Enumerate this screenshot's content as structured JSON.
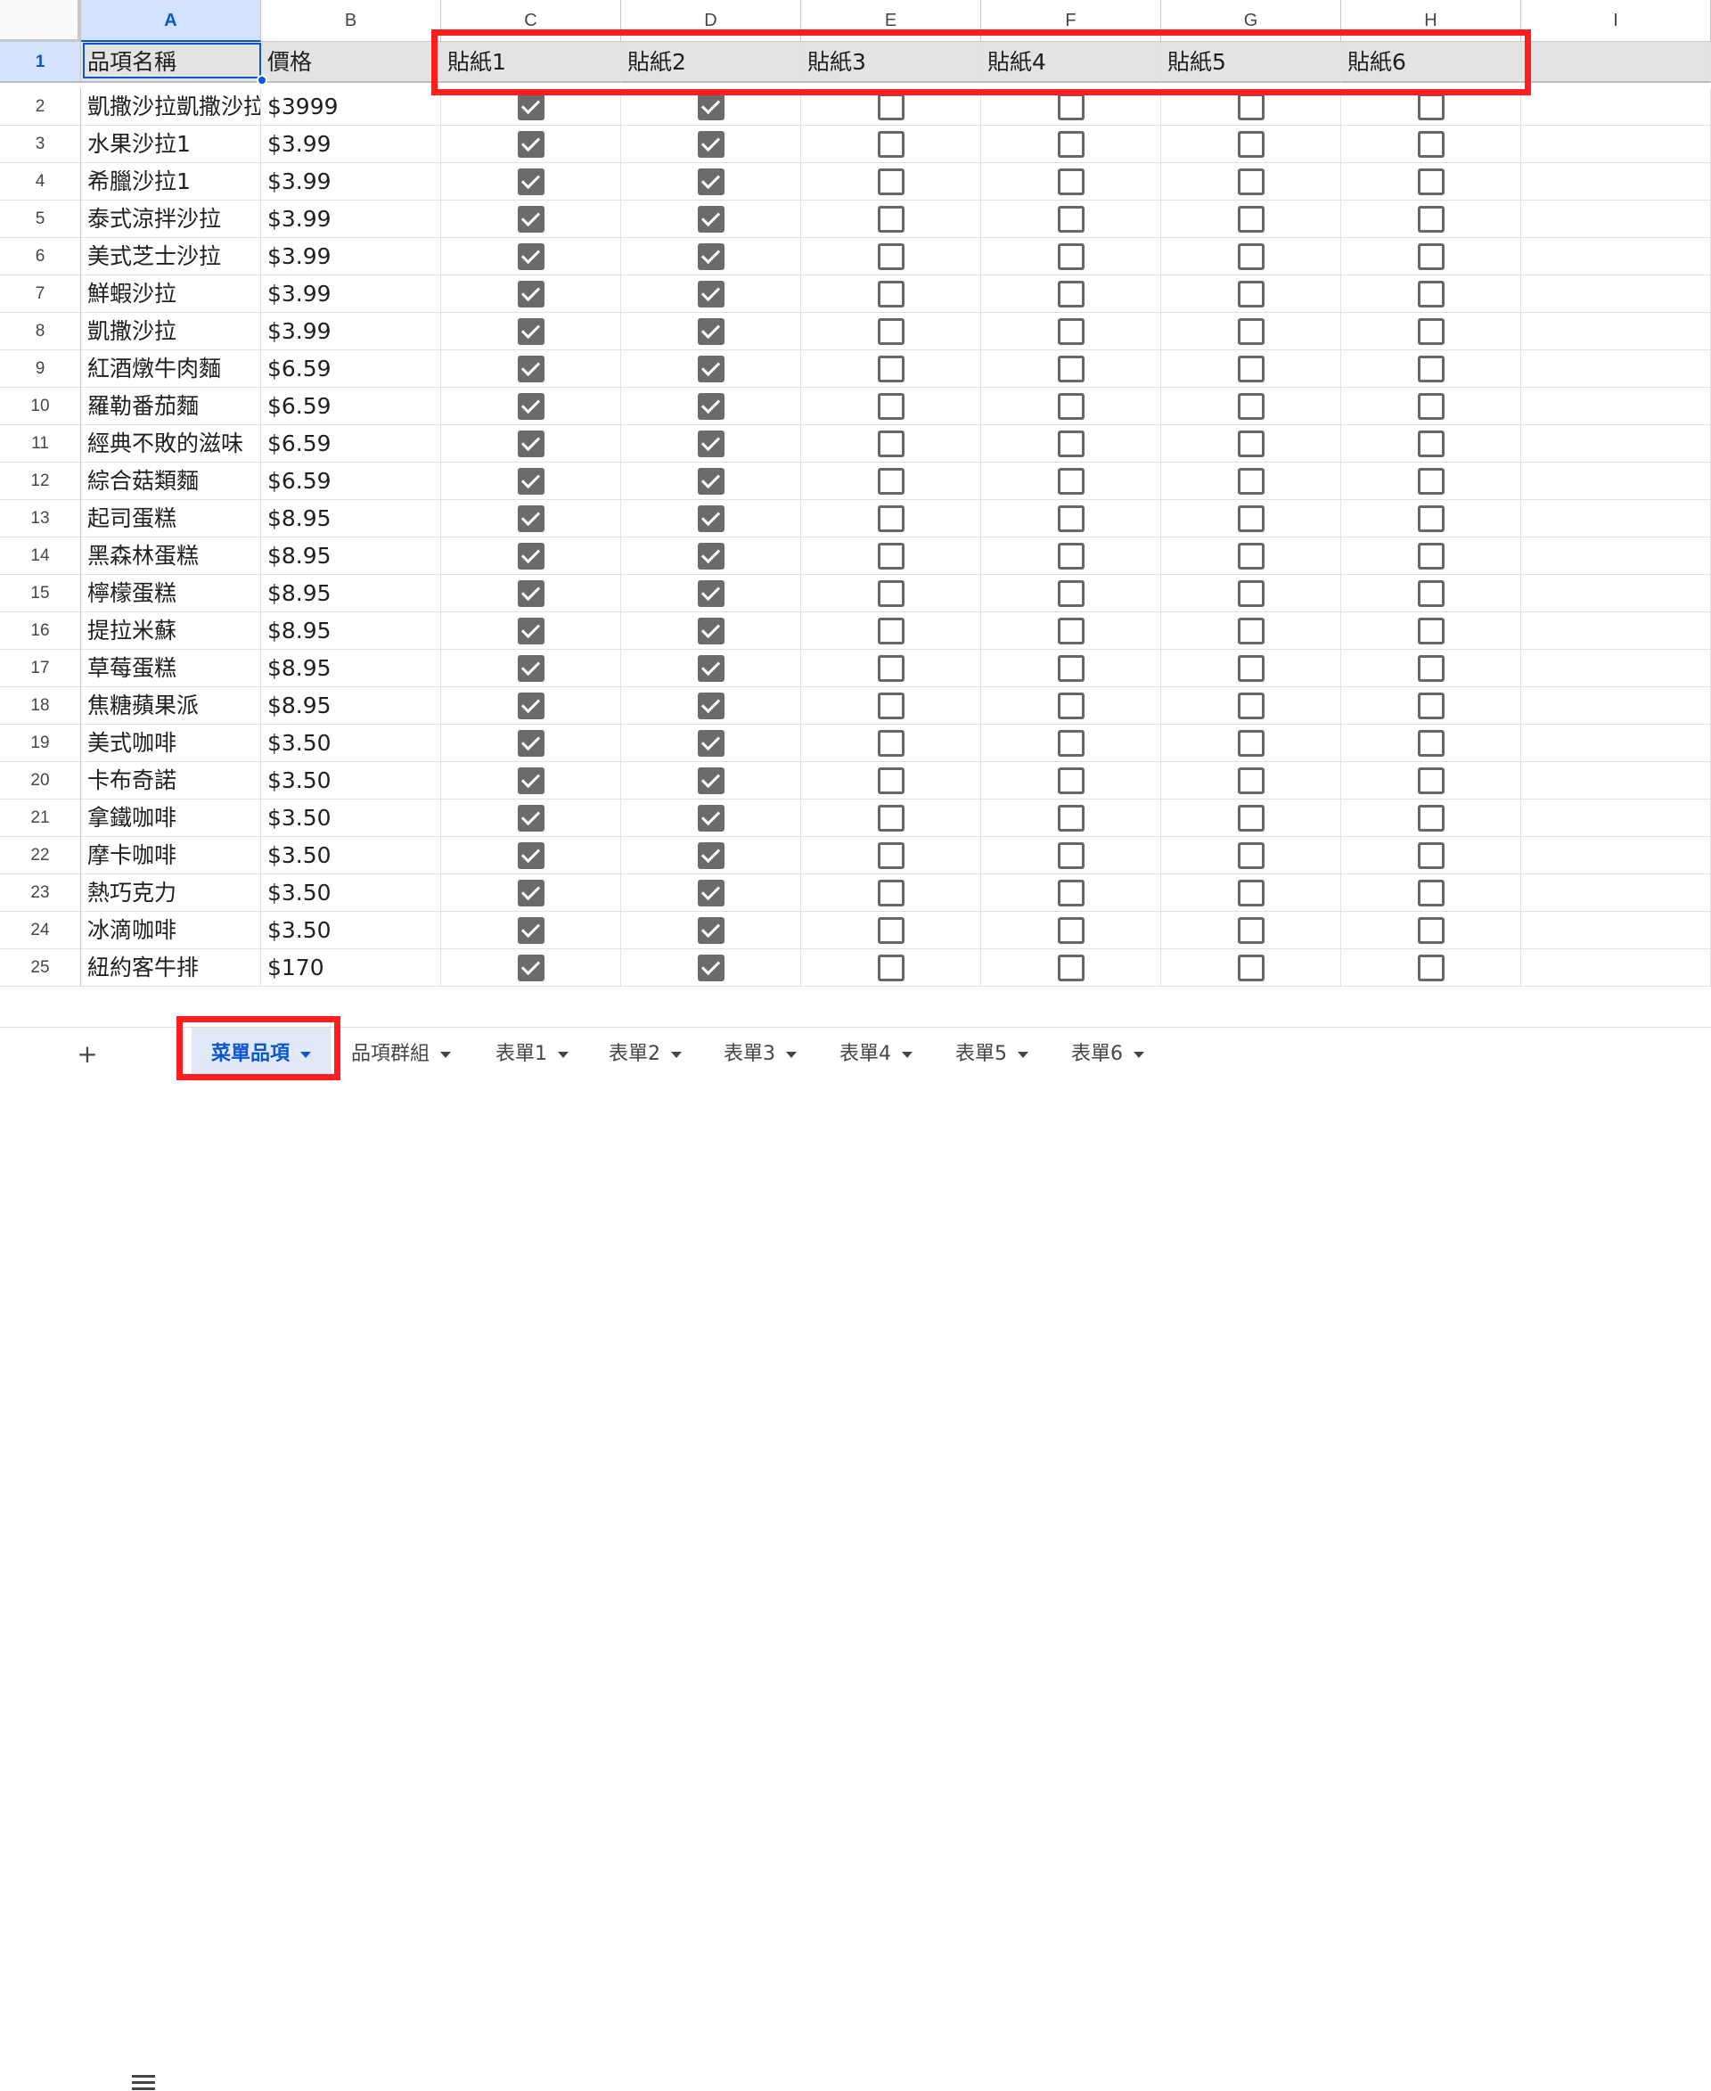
{
  "columns": [
    "A",
    "B",
    "C",
    "D",
    "E",
    "F",
    "G",
    "H",
    "I"
  ],
  "selected_column": "A",
  "selected_row": "1",
  "header_row": {
    "row_number": "1",
    "cells": [
      "品項名稱",
      "價格",
      "貼紙1",
      "貼紙2",
      "貼紙3",
      "貼紙4",
      "貼紙5",
      "貼紙6",
      ""
    ]
  },
  "rows": [
    {
      "n": "2",
      "name": "凱撒沙拉凱撒沙拉",
      "price": "$3999",
      "checks": [
        true,
        true,
        false,
        false,
        false,
        false
      ]
    },
    {
      "n": "3",
      "name": "水果沙拉1",
      "price": "$3.99",
      "checks": [
        true,
        true,
        false,
        false,
        false,
        false
      ]
    },
    {
      "n": "4",
      "name": "希臘沙拉1",
      "price": "$3.99",
      "checks": [
        true,
        true,
        false,
        false,
        false,
        false
      ]
    },
    {
      "n": "5",
      "name": "泰式涼拌沙拉",
      "price": "$3.99",
      "checks": [
        true,
        true,
        false,
        false,
        false,
        false
      ]
    },
    {
      "n": "6",
      "name": "美式芝士沙拉",
      "price": "$3.99",
      "checks": [
        true,
        true,
        false,
        false,
        false,
        false
      ]
    },
    {
      "n": "7",
      "name": "鮮蝦沙拉",
      "price": "$3.99",
      "checks": [
        true,
        true,
        false,
        false,
        false,
        false
      ]
    },
    {
      "n": "8",
      "name": "凱撒沙拉",
      "price": "$3.99",
      "checks": [
        true,
        true,
        false,
        false,
        false,
        false
      ]
    },
    {
      "n": "9",
      "name": "紅酒燉牛肉麵",
      "price": "$6.59",
      "checks": [
        true,
        true,
        false,
        false,
        false,
        false
      ]
    },
    {
      "n": "10",
      "name": "羅勒番茄麵",
      "price": "$6.59",
      "checks": [
        true,
        true,
        false,
        false,
        false,
        false
      ]
    },
    {
      "n": "11",
      "name": "經典不敗的滋味",
      "price": "$6.59",
      "checks": [
        true,
        true,
        false,
        false,
        false,
        false
      ]
    },
    {
      "n": "12",
      "name": "綜合菇類麵",
      "price": "$6.59",
      "checks": [
        true,
        true,
        false,
        false,
        false,
        false
      ]
    },
    {
      "n": "13",
      "name": "起司蛋糕",
      "price": "$8.95",
      "checks": [
        true,
        true,
        false,
        false,
        false,
        false
      ]
    },
    {
      "n": "14",
      "name": "黑森林蛋糕",
      "price": "$8.95",
      "checks": [
        true,
        true,
        false,
        false,
        false,
        false
      ]
    },
    {
      "n": "15",
      "name": "檸檬蛋糕",
      "price": "$8.95",
      "checks": [
        true,
        true,
        false,
        false,
        false,
        false
      ]
    },
    {
      "n": "16",
      "name": "提拉米蘇",
      "price": "$8.95",
      "checks": [
        true,
        true,
        false,
        false,
        false,
        false
      ]
    },
    {
      "n": "17",
      "name": "草莓蛋糕",
      "price": "$8.95",
      "checks": [
        true,
        true,
        false,
        false,
        false,
        false
      ]
    },
    {
      "n": "18",
      "name": "焦糖蘋果派",
      "price": "$8.95",
      "checks": [
        true,
        true,
        false,
        false,
        false,
        false
      ]
    },
    {
      "n": "19",
      "name": "美式咖啡",
      "price": "$3.50",
      "checks": [
        true,
        true,
        false,
        false,
        false,
        false
      ]
    },
    {
      "n": "20",
      "name": "卡布奇諾",
      "price": "$3.50",
      "checks": [
        true,
        true,
        false,
        false,
        false,
        false
      ]
    },
    {
      "n": "21",
      "name": "拿鐵咖啡",
      "price": "$3.50",
      "checks": [
        true,
        true,
        false,
        false,
        false,
        false
      ]
    },
    {
      "n": "22",
      "name": "摩卡咖啡",
      "price": "$3.50",
      "checks": [
        true,
        true,
        false,
        false,
        false,
        false
      ]
    },
    {
      "n": "23",
      "name": "熱巧克力",
      "price": "$3.50",
      "checks": [
        true,
        true,
        false,
        false,
        false,
        false
      ]
    },
    {
      "n": "24",
      "name": "冰滴咖啡",
      "price": "$3.50",
      "checks": [
        true,
        true,
        false,
        false,
        false,
        false
      ]
    },
    {
      "n": "25",
      "name": "紐約客牛排",
      "price": "$170",
      "checks": [
        true,
        true,
        false,
        false,
        false,
        false
      ]
    }
  ],
  "toolbar": {
    "add_sheet": "+",
    "all_sheets": "≡"
  },
  "sheet_tabs": [
    {
      "label": "菜單品項",
      "active": true
    },
    {
      "label": "品項群組",
      "active": false
    },
    {
      "label": "表單1",
      "active": false
    },
    {
      "label": "表單2",
      "active": false
    },
    {
      "label": "表單3",
      "active": false
    },
    {
      "label": "表單4",
      "active": false
    },
    {
      "label": "表單5",
      "active": false
    },
    {
      "label": "表單6",
      "active": false
    }
  ],
  "colors": {
    "accent": "#0b57d0",
    "highlight": "#ff1e1e",
    "header_fill": "#e3e3e3",
    "checked": "#6b6b6b"
  }
}
